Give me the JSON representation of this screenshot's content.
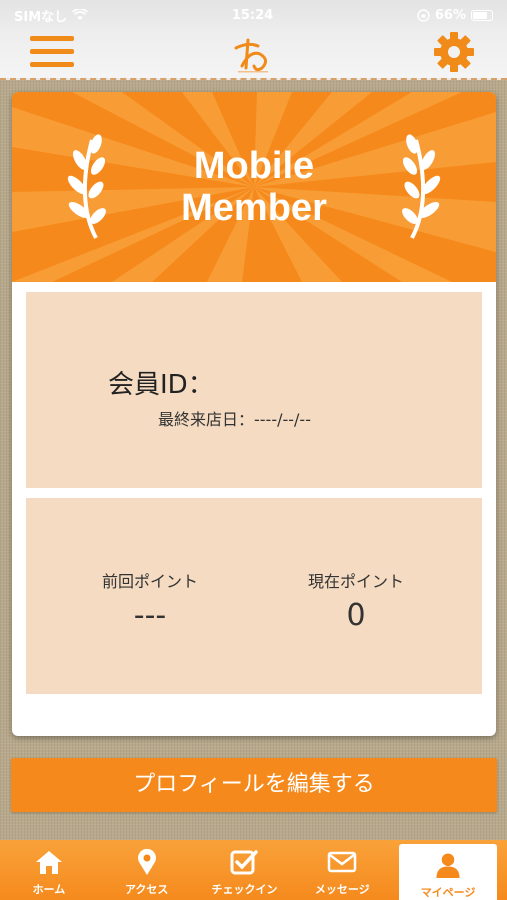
{
  "statusbar": {
    "carrier": "SIMなし",
    "time": "15:24",
    "battery": "66%"
  },
  "header": {
    "menu_icon": "hamburger-menu-icon",
    "logo_icon": "brand-logo",
    "settings_icon": "gear-icon"
  },
  "banner": {
    "line1": "Mobile",
    "line2": "Member"
  },
  "member": {
    "id_label": "会員ID：",
    "last_visit": "最終来店日：----/--/--"
  },
  "points": {
    "previous_label": "前回ポイント",
    "previous_value": "---",
    "current_label": "現在ポイント",
    "current_value": "0"
  },
  "edit_profile_label": "プロフィールを編集する",
  "tabs": [
    {
      "label": "ホーム",
      "icon": "home-icon"
    },
    {
      "label": "アクセス",
      "icon": "map-pin-icon"
    },
    {
      "label": "チェックイン",
      "icon": "checkin-icon"
    },
    {
      "label": "メッセージ",
      "icon": "envelope-icon"
    },
    {
      "label": "マイページ",
      "icon": "user-icon"
    }
  ],
  "colors": {
    "accent": "#f6891b",
    "panel": "#f4dbc2"
  }
}
